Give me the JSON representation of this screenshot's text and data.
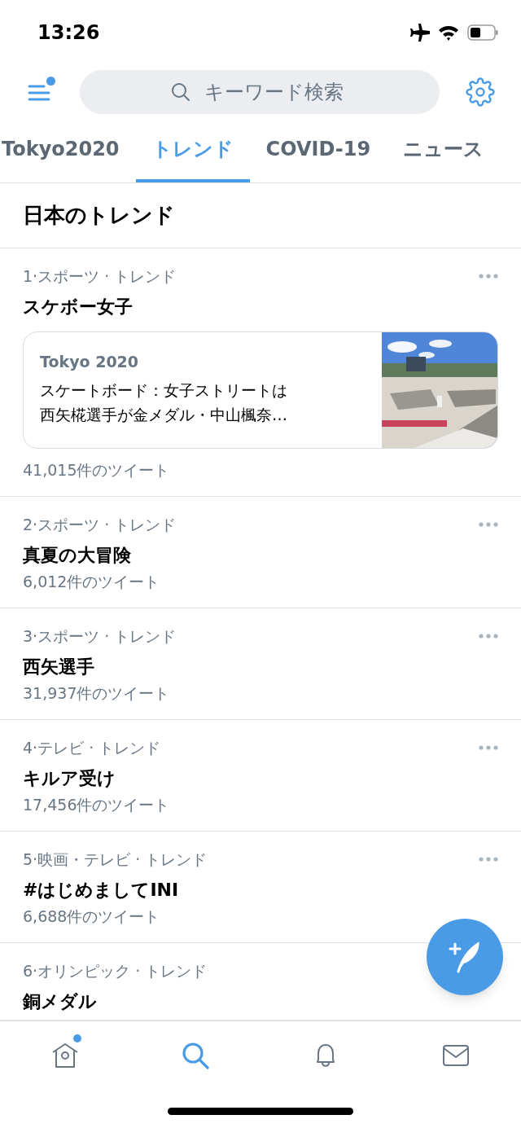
{
  "status_bar": {
    "time": "13:26"
  },
  "header": {
    "menu_badge": true,
    "search": {
      "placeholder": "キーワード検索"
    }
  },
  "tabs": [
    {
      "label": "Tokyo2020",
      "selected": false
    },
    {
      "label": "トレンド",
      "selected": true
    },
    {
      "label": "COVID-19",
      "selected": false
    },
    {
      "label": "ニュース",
      "selected": false
    }
  ],
  "section_title": "日本のトレンド",
  "trends": [
    {
      "rank": "1·",
      "context": "スポーツ · トレンド",
      "title": "スケボー女子",
      "card": {
        "source": "Tokyo 2020",
        "headline": "スケートボード：女子ストリートは西矢椛選手が金メダル・中山楓奈…",
        "kind": "picture"
      },
      "count": "41,015件のツイート",
      "more": true
    },
    {
      "rank": "2·",
      "context": "スポーツ · トレンド",
      "title": "真夏の大冒険",
      "count": "6,012件のツイート",
      "more": true
    },
    {
      "rank": "3·",
      "context": "スポーツ · トレンド",
      "title": "西矢選手",
      "count": "31,937件のツイート",
      "more": true
    },
    {
      "rank": "4·",
      "context": "テレビ · トレンド",
      "title": "キルア受け",
      "count": "17,456件のツイート",
      "more": true
    },
    {
      "rank": "5·",
      "context": "映画・テレビ · トレンド",
      "title": "#はじめましてINI",
      "count": "6,688件のツイート",
      "more": true
    },
    {
      "rank": "6·",
      "context": "オリンピック · トレンド",
      "title": "銅メダル"
    }
  ],
  "bottom_nav": [
    {
      "kind": "home",
      "selected": false,
      "badge": true
    },
    {
      "kind": "search",
      "selected": true,
      "badge": false
    },
    {
      "kind": "notifications",
      "selected": false,
      "badge": false
    },
    {
      "kind": "messages",
      "selected": false,
      "badge": false
    }
  ]
}
